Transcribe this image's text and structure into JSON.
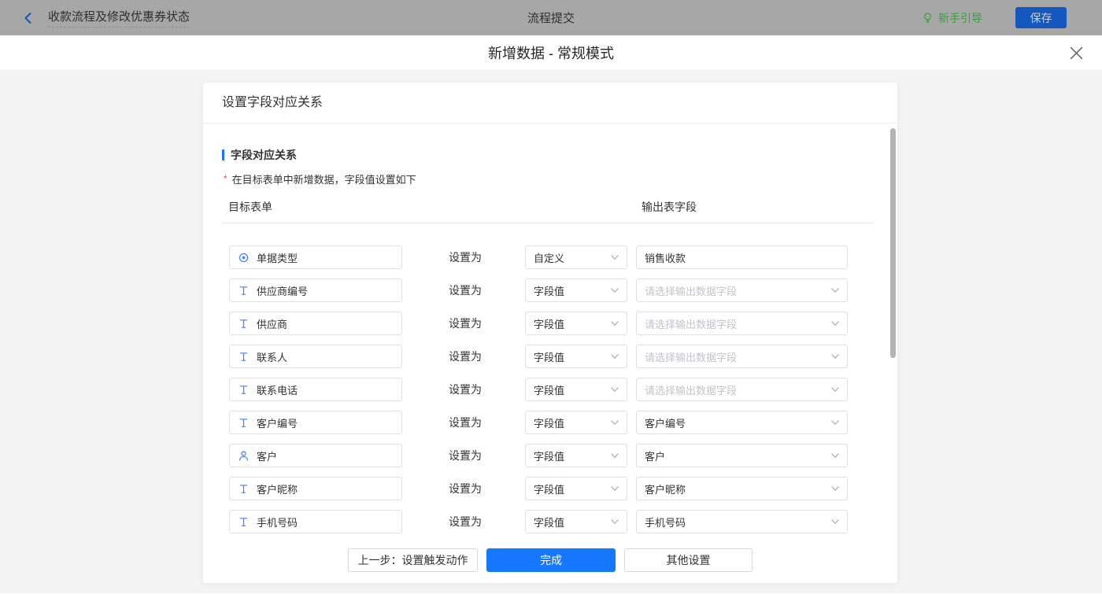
{
  "topbar": {
    "flow_title": "收款流程及修改优惠券状态",
    "center_title": "流程提交",
    "guide_label": "新手引导",
    "save_label": "保存"
  },
  "modal": {
    "title": "新增数据 - 常规模式"
  },
  "panel": {
    "header": "设置字段对应关系",
    "section_title": "字段对应关系",
    "required_mark": "*",
    "note": "在目标表单中新增数据，字段值设置如下",
    "columns": {
      "target": "目标表单",
      "output": "输出表字段"
    },
    "set_as_label": "设置为",
    "output_placeholder": "请选择输出数据字段",
    "rows": [
      {
        "icon": "radio-icon",
        "field": "单据类型",
        "mode": "自定义",
        "output": {
          "kind": "text-input",
          "value": "销售收款",
          "placeholder": false
        }
      },
      {
        "icon": "text-icon",
        "field": "供应商编号",
        "mode": "字段值",
        "output": {
          "kind": "select",
          "value": "请选择输出数据字段",
          "placeholder": true
        }
      },
      {
        "icon": "text-icon",
        "field": "供应商",
        "mode": "字段值",
        "output": {
          "kind": "select",
          "value": "请选择输出数据字段",
          "placeholder": true
        }
      },
      {
        "icon": "text-icon",
        "field": "联系人",
        "mode": "字段值",
        "output": {
          "kind": "select",
          "value": "请选择输出数据字段",
          "placeholder": true
        }
      },
      {
        "icon": "text-icon",
        "field": "联系电话",
        "mode": "字段值",
        "output": {
          "kind": "select",
          "value": "请选择输出数据字段",
          "placeholder": true
        }
      },
      {
        "icon": "text-icon",
        "field": "客户编号",
        "mode": "字段值",
        "output": {
          "kind": "select",
          "value": "客户编号",
          "placeholder": false
        }
      },
      {
        "icon": "user-icon",
        "field": "客户",
        "mode": "字段值",
        "output": {
          "kind": "select",
          "value": "客户",
          "placeholder": false
        }
      },
      {
        "icon": "text-icon",
        "field": "客户昵称",
        "mode": "字段值",
        "output": {
          "kind": "select",
          "value": "客户昵称",
          "placeholder": false
        }
      },
      {
        "icon": "text-icon",
        "field": "手机号码",
        "mode": "字段值",
        "output": {
          "kind": "select",
          "value": "手机号码",
          "placeholder": false
        }
      },
      {
        "partial": true,
        "icon": "",
        "field": "",
        "mode": "",
        "output": {
          "kind": "select",
          "value": "",
          "placeholder": false
        }
      }
    ],
    "footer": {
      "prev_label": "上一步：设置触发动作",
      "done_label": "完成",
      "other_label": "其他设置"
    }
  },
  "colors": {
    "accent_blue": "#1677ff",
    "field_icon_blue": "#4b7bf5",
    "guide_green": "#3c9e3e",
    "topbar_bg": "#a7a7a7",
    "required_red": "#f2483d",
    "page_bg": "#f4f4f4",
    "scrollbar": "#b4b4b4"
  }
}
